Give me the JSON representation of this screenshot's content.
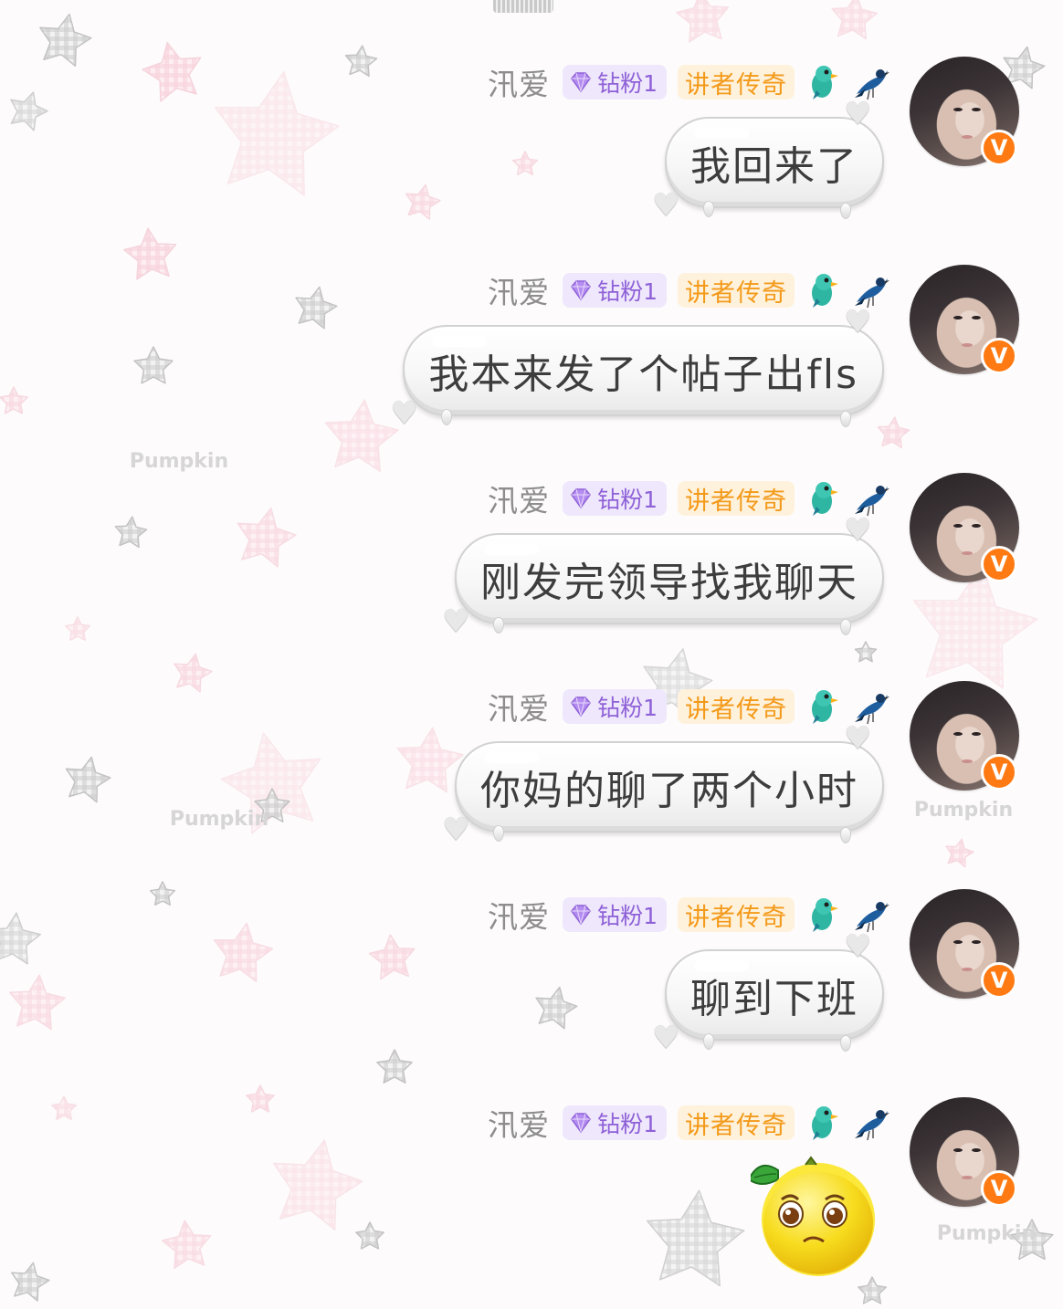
{
  "background": {
    "watermark": "Pumpkin"
  },
  "sender": {
    "name": "汛爱",
    "fan_badge": "钻粉1",
    "title_badge": "讲者传奇",
    "verified_mark": "V"
  },
  "messages": [
    {
      "text": "我回来了"
    },
    {
      "text": "我本来发了个帖子出fls"
    },
    {
      "text": "刚发完领导找我聊天"
    },
    {
      "text": "你妈的聊了两个小时"
    },
    {
      "text": "聊到下班"
    },
    {
      "sticker": "lemon-worried-face-sticker"
    }
  ],
  "colors": {
    "name": "#8d8d8d",
    "fan_badge_text": "#8e61d7",
    "fan_badge_bg": "#efe7fb",
    "title_badge_text": "#f39a1a",
    "title_badge_bg": "#fff2dc",
    "verified": "#ff7a12"
  }
}
